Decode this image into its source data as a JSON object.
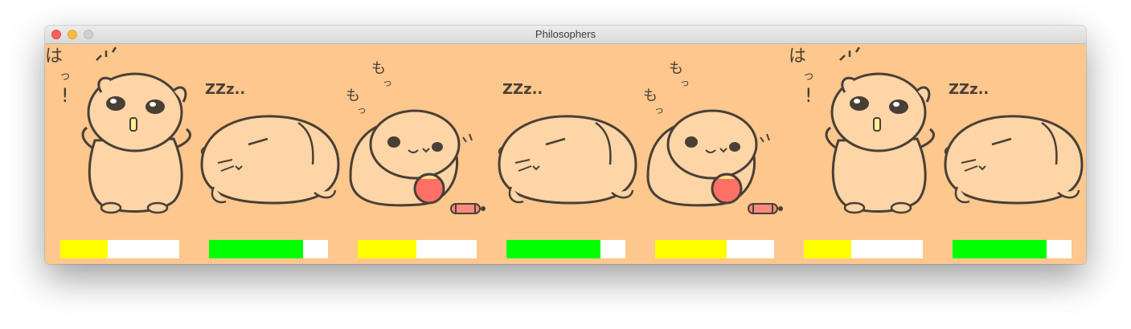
{
  "window": {
    "title": "Philosophers"
  },
  "philosophers": [
    {
      "state": "awake",
      "bar_color": "#ffff00",
      "bar_fraction": 0.4
    },
    {
      "state": "sleeping",
      "bar_color": "#00ff00",
      "bar_fraction": 0.79,
      "caption": "ZZz.."
    },
    {
      "state": "eating",
      "bar_color": "#ffff00",
      "bar_fraction": 0.49
    },
    {
      "state": "sleeping",
      "bar_color": "#00ff00",
      "bar_fraction": 0.79,
      "caption": "ZZz.."
    },
    {
      "state": "eating",
      "bar_color": "#ffff00",
      "bar_fraction": 0.6
    },
    {
      "state": "awake",
      "bar_color": "#ffff00",
      "bar_fraction": 0.4
    },
    {
      "state": "sleeping",
      "bar_color": "#00ff00",
      "bar_fraction": 0.79,
      "caption": "ZZz.."
    }
  ]
}
